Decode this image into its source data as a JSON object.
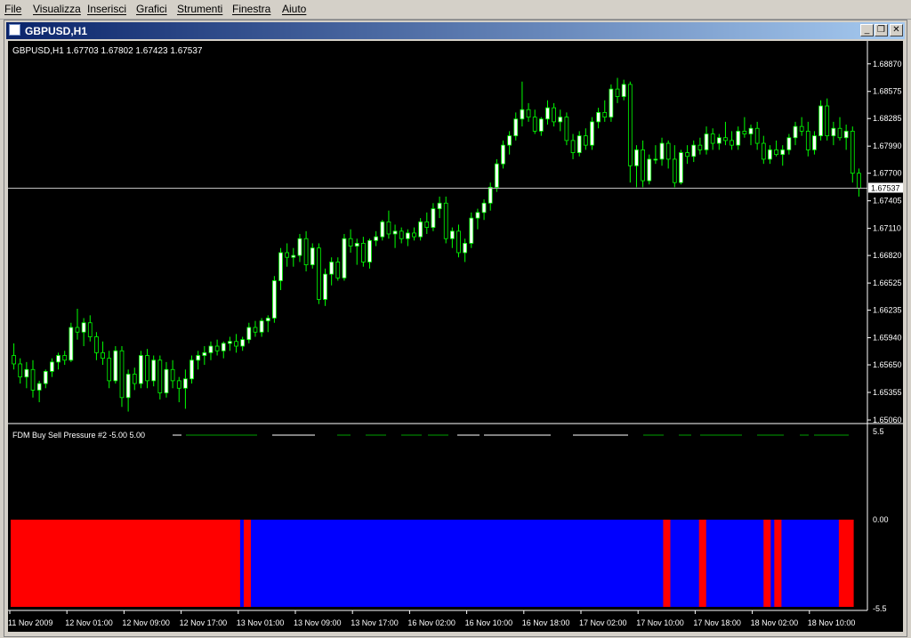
{
  "menu": [
    "File",
    "Visualizza",
    "Inserisci",
    "Grafici",
    "Strumenti",
    "Finestra",
    "Aiuto"
  ],
  "window": {
    "title": "GBPUSD,H1",
    "buttons": {
      "minimize": "_",
      "restore": "❐",
      "close": "✕"
    }
  },
  "main_chart": {
    "info": "GBPUSD,H1  1.67703  1.67802  1.67423  1.67537",
    "price_labels": [
      "1.68870",
      "1.68575",
      "1.68285",
      "1.67990",
      "1.67700",
      "1.67405",
      "1.67110",
      "1.66820",
      "1.66525",
      "1.66235",
      "1.65940",
      "1.65650",
      "1.65355",
      "1.65060"
    ],
    "current_price": "1.67537",
    "colors": {
      "bull": "#ffffff",
      "bear": "#00ff00",
      "wick": "#00ff00",
      "background": "#000000",
      "price_line": "#c0c0c0"
    }
  },
  "indicator": {
    "title": "FDM Buy Sell Pressure #2 -5.00  5.00",
    "scale_labels": [
      "5.5",
      "0.00",
      "-5.5"
    ],
    "colors": {
      "sell": "#ff0000",
      "buy": "#0000ff"
    }
  },
  "time_labels": [
    "11 Nov 2009",
    "12 Nov 01:00",
    "12 Nov 09:00",
    "12 Nov 17:00",
    "13 Nov 01:00",
    "13 Nov 09:00",
    "13 Nov 17:00",
    "16 Nov 02:00",
    "16 Nov 10:00",
    "16 Nov 18:00",
    "17 Nov 02:00",
    "17 Nov 10:00",
    "17 Nov 18:00",
    "18 Nov 02:00",
    "18 Nov 10:00"
  ],
  "chart_data": {
    "type": "candlestick",
    "symbol": "GBPUSD",
    "timeframe": "H1",
    "ylim": [
      1.6506,
      1.6902
    ],
    "candles": [
      [
        1.6575,
        1.6588,
        1.656,
        1.6566
      ],
      [
        1.6566,
        1.6572,
        1.6545,
        1.6552
      ],
      [
        1.6552,
        1.6568,
        1.654,
        1.656
      ],
      [
        1.656,
        1.657,
        1.653,
        1.6538
      ],
      [
        1.6538,
        1.6548,
        1.6525,
        1.6545
      ],
      [
        1.6545,
        1.656,
        1.654,
        1.6558
      ],
      [
        1.6558,
        1.6572,
        1.6552,
        1.6568
      ],
      [
        1.6568,
        1.6578,
        1.656,
        1.6575
      ],
      [
        1.6575,
        1.658,
        1.6565,
        1.657
      ],
      [
        1.657,
        1.661,
        1.6568,
        1.6605
      ],
      [
        1.6605,
        1.6625,
        1.6592,
        1.66
      ],
      [
        1.66,
        1.6615,
        1.6585,
        1.661
      ],
      [
        1.661,
        1.6618,
        1.659,
        1.6595
      ],
      [
        1.6595,
        1.66,
        1.657,
        1.6578
      ],
      [
        1.6578,
        1.659,
        1.6565,
        1.6572
      ],
      [
        1.6572,
        1.658,
        1.654,
        1.6548
      ],
      [
        1.6548,
        1.6585,
        1.6545,
        1.658
      ],
      [
        1.658,
        1.6585,
        1.652,
        1.653
      ],
      [
        1.653,
        1.656,
        1.6515,
        1.6555
      ],
      [
        1.6555,
        1.6562,
        1.6538,
        1.6545
      ],
      [
        1.6545,
        1.658,
        1.654,
        1.6575
      ],
      [
        1.6575,
        1.6582,
        1.654,
        1.6548
      ],
      [
        1.6548,
        1.6575,
        1.6542,
        1.657
      ],
      [
        1.657,
        1.6575,
        1.6528,
        1.6535
      ],
      [
        1.6535,
        1.6568,
        1.653,
        1.656
      ],
      [
        1.656,
        1.657,
        1.654,
        1.6548
      ],
      [
        1.6548,
        1.6552,
        1.6525,
        1.654
      ],
      [
        1.654,
        1.656,
        1.6518,
        1.655
      ],
      [
        1.655,
        1.6575,
        1.6545,
        1.657
      ],
      [
        1.657,
        1.658,
        1.656,
        1.6575
      ],
      [
        1.6575,
        1.6585,
        1.6565,
        1.6578
      ],
      [
        1.6578,
        1.659,
        1.657,
        1.6585
      ],
      [
        1.6585,
        1.6592,
        1.6575,
        1.658
      ],
      [
        1.658,
        1.659,
        1.6572,
        1.6588
      ],
      [
        1.6588,
        1.6595,
        1.658,
        1.659
      ],
      [
        1.659,
        1.6598,
        1.6578,
        1.6585
      ],
      [
        1.6585,
        1.6595,
        1.658,
        1.6592
      ],
      [
        1.6592,
        1.661,
        1.6588,
        1.6605
      ],
      [
        1.6605,
        1.6612,
        1.6595,
        1.66
      ],
      [
        1.66,
        1.6615,
        1.6595,
        1.6612
      ],
      [
        1.6612,
        1.6618,
        1.66,
        1.6615
      ],
      [
        1.6615,
        1.666,
        1.661,
        1.6655
      ],
      [
        1.6655,
        1.669,
        1.6645,
        1.6685
      ],
      [
        1.6685,
        1.6695,
        1.667,
        1.668
      ],
      [
        1.668,
        1.669,
        1.667,
        1.6682
      ],
      [
        1.6682,
        1.6705,
        1.6675,
        1.67
      ],
      [
        1.67,
        1.6708,
        1.6665,
        1.6672
      ],
      [
        1.6672,
        1.6695,
        1.6668,
        1.669
      ],
      [
        1.669,
        1.6695,
        1.663,
        1.6635
      ],
      [
        1.6635,
        1.6668,
        1.6628,
        1.6662
      ],
      [
        1.6662,
        1.668,
        1.665,
        1.6675
      ],
      [
        1.6675,
        1.668,
        1.6655,
        1.6658
      ],
      [
        1.6658,
        1.6705,
        1.6655,
        1.67
      ],
      [
        1.67,
        1.671,
        1.6685,
        1.6692
      ],
      [
        1.6692,
        1.67,
        1.6672,
        1.6695
      ],
      [
        1.6695,
        1.6702,
        1.667,
        1.6675
      ],
      [
        1.6675,
        1.67,
        1.6668,
        1.6698
      ],
      [
        1.6698,
        1.6708,
        1.6692,
        1.6702
      ],
      [
        1.6702,
        1.672,
        1.6698,
        1.6718
      ],
      [
        1.6718,
        1.673,
        1.67,
        1.6705
      ],
      [
        1.6705,
        1.6715,
        1.669,
        1.6708
      ],
      [
        1.6708,
        1.6712,
        1.6695,
        1.67
      ],
      [
        1.67,
        1.671,
        1.6692,
        1.6706
      ],
      [
        1.6706,
        1.6712,
        1.6698,
        1.6702
      ],
      [
        1.6702,
        1.6722,
        1.6698,
        1.6718
      ],
      [
        1.6718,
        1.6728,
        1.6705,
        1.6712
      ],
      [
        1.6712,
        1.6738,
        1.6708,
        1.6732
      ],
      [
        1.6732,
        1.6745,
        1.6722,
        1.6738
      ],
      [
        1.6738,
        1.6745,
        1.6695,
        1.67
      ],
      [
        1.67,
        1.6712,
        1.669,
        1.6708
      ],
      [
        1.6708,
        1.6715,
        1.668,
        1.6685
      ],
      [
        1.6685,
        1.67,
        1.6675,
        1.6695
      ],
      [
        1.6695,
        1.6728,
        1.669,
        1.6722
      ],
      [
        1.6722,
        1.6732,
        1.671,
        1.6728
      ],
      [
        1.6728,
        1.6742,
        1.672,
        1.6738
      ],
      [
        1.6738,
        1.676,
        1.673,
        1.6755
      ],
      [
        1.6755,
        1.6785,
        1.675,
        1.678
      ],
      [
        1.678,
        1.6805,
        1.6775,
        1.68
      ],
      [
        1.68,
        1.6815,
        1.679,
        1.681
      ],
      [
        1.681,
        1.6835,
        1.6805,
        1.6828
      ],
      [
        1.6828,
        1.6868,
        1.682,
        1.6838
      ],
      [
        1.6838,
        1.6845,
        1.6825,
        1.683
      ],
      [
        1.683,
        1.6838,
        1.6812,
        1.6815
      ],
      [
        1.6815,
        1.683,
        1.681,
        1.6828
      ],
      [
        1.6828,
        1.6848,
        1.6822,
        1.684
      ],
      [
        1.684,
        1.6845,
        1.682,
        1.6825
      ],
      [
        1.6825,
        1.6838,
        1.6815,
        1.683
      ],
      [
        1.683,
        1.6835,
        1.68,
        1.6805
      ],
      [
        1.6805,
        1.6812,
        1.6785,
        1.6792
      ],
      [
        1.6792,
        1.6815,
        1.6788,
        1.681
      ],
      [
        1.681,
        1.6818,
        1.6795,
        1.68
      ],
      [
        1.68,
        1.683,
        1.6795,
        1.6825
      ],
      [
        1.6825,
        1.684,
        1.6818,
        1.6835
      ],
      [
        1.6835,
        1.6848,
        1.6825,
        1.683
      ],
      [
        1.683,
        1.6865,
        1.6825,
        1.686
      ],
      [
        1.686,
        1.6872,
        1.6845,
        1.6852
      ],
      [
        1.6852,
        1.687,
        1.6848,
        1.6865
      ],
      [
        1.6865,
        1.6868,
        1.676,
        1.6778
      ],
      [
        1.6778,
        1.68,
        1.6755,
        1.6795
      ],
      [
        1.6795,
        1.6805,
        1.6755,
        1.6762
      ],
      [
        1.6762,
        1.679,
        1.6758,
        1.6785
      ],
      [
        1.6785,
        1.68,
        1.678,
        1.6785
      ],
      [
        1.6785,
        1.6808,
        1.6778,
        1.6802
      ],
      [
        1.6802,
        1.6805,
        1.6775,
        1.6785
      ],
      [
        1.6785,
        1.68,
        1.6755,
        1.676
      ],
      [
        1.676,
        1.6795,
        1.6758,
        1.6792
      ],
      [
        1.6792,
        1.68,
        1.678,
        1.6788
      ],
      [
        1.6788,
        1.6805,
        1.6782,
        1.68
      ],
      [
        1.68,
        1.6808,
        1.679,
        1.6795
      ],
      [
        1.6795,
        1.682,
        1.679,
        1.6812
      ],
      [
        1.6812,
        1.6818,
        1.6795,
        1.6802
      ],
      [
        1.6802,
        1.6812,
        1.6795,
        1.6808
      ],
      [
        1.6808,
        1.6825,
        1.68,
        1.6805
      ],
      [
        1.6805,
        1.6815,
        1.6795,
        1.68
      ],
      [
        1.68,
        1.682,
        1.6795,
        1.6815
      ],
      [
        1.6815,
        1.683,
        1.6808,
        1.6812
      ],
      [
        1.6812,
        1.6822,
        1.68,
        1.6818
      ],
      [
        1.6818,
        1.6825,
        1.6795,
        1.6802
      ],
      [
        1.6802,
        1.681,
        1.678,
        1.6785
      ],
      [
        1.6785,
        1.68,
        1.678,
        1.6795
      ],
      [
        1.6795,
        1.6805,
        1.6788,
        1.679
      ],
      [
        1.679,
        1.68,
        1.6778,
        1.6795
      ],
      [
        1.6795,
        1.6812,
        1.679,
        1.6808
      ],
      [
        1.6808,
        1.6825,
        1.68,
        1.682
      ],
      [
        1.682,
        1.683,
        1.681,
        1.6815
      ],
      [
        1.6815,
        1.6825,
        1.6788,
        1.6795
      ],
      [
        1.6795,
        1.6815,
        1.679,
        1.681
      ],
      [
        1.681,
        1.6848,
        1.6805,
        1.6842
      ],
      [
        1.6842,
        1.685,
        1.6805,
        1.681
      ],
      [
        1.681,
        1.6825,
        1.68,
        1.6818
      ],
      [
        1.6818,
        1.683,
        1.6805,
        1.6808
      ],
      [
        1.6808,
        1.6822,
        1.6795,
        1.6815
      ],
      [
        1.6815,
        1.682,
        1.676,
        1.677
      ],
      [
        1.677,
        1.6775,
        1.6745,
        1.6754
      ]
    ],
    "indicator": {
      "name": "FDM Buy Sell Pressure #2",
      "ylim": [
        -5.5,
        5.5
      ],
      "bars": [
        "S",
        "S",
        "S",
        "S",
        "S",
        "S",
        "S",
        "S",
        "S",
        "S",
        "S",
        "S",
        "S",
        "S",
        "S",
        "S",
        "S",
        "S",
        "S",
        "S",
        "S",
        "S",
        "S",
        "S",
        "S",
        "S",
        "S",
        "S",
        "S",
        "S",
        "S",
        "S",
        "S",
        "S",
        "S",
        "S",
        "S",
        "S",
        "S",
        "S",
        "S",
        "S",
        "S",
        "S",
        "S",
        "S",
        "S",
        "S",
        "S",
        "S",
        "S",
        "S",
        "S",
        "S",
        "S",
        "S",
        "S",
        "S",
        "S",
        "S",
        "S",
        "S",
        "S",
        "S",
        "B",
        "S",
        "S",
        "B",
        "B",
        "B",
        "B",
        "B",
        "B",
        "B",
        "B",
        "B",
        "B",
        "B",
        "B",
        "B",
        "B",
        "B",
        "B",
        "B",
        "B",
        "B",
        "B",
        "B",
        "B",
        "B",
        "B",
        "B",
        "B",
        "B",
        "B",
        "B",
        "B",
        "B",
        "B",
        "B",
        "B",
        "B",
        "B",
        "B",
        "B",
        "B",
        "B",
        "B",
        "B",
        "B",
        "B",
        "B",
        "B",
        "B",
        "B",
        "B",
        "B",
        "B",
        "B",
        "B",
        "B",
        "B",
        "B",
        "B",
        "B",
        "B",
        "B",
        "B",
        "B",
        "B",
        "B",
        "B",
        "B",
        "B",
        "B",
        "B",
        "B",
        "B",
        "B",
        "B",
        "B",
        "B",
        "B",
        "B",
        "B",
        "B",
        "B",
        "B",
        "B",
        "B",
        "B",
        "B",
        "B",
        "B",
        "B",
        "B",
        "B",
        "B",
        "B",
        "B",
        "B",
        "B",
        "B",
        "B",
        "B",
        "B",
        "B",
        "B",
        "B",
        "B",
        "B",
        "B",
        "B",
        "B",
        "B",
        "B",
        "B",
        "B",
        "B",
        "B",
        "B",
        "B",
        "S",
        "S",
        "B",
        "B",
        "B",
        "B",
        "B",
        "B",
        "B",
        "B",
        "S",
        "S",
        "B",
        "B",
        "B",
        "B",
        "B",
        "B",
        "B",
        "B",
        "B",
        "B",
        "B",
        "B",
        "B",
        "B",
        "B",
        "B",
        "S",
        "S",
        "B",
        "S",
        "S",
        "B",
        "B",
        "B",
        "B",
        "B",
        "B",
        "B",
        "B",
        "B",
        "B",
        "B",
        "B",
        "B",
        "B",
        "B",
        "B",
        "S",
        "S",
        "S",
        "S"
      ]
    }
  }
}
